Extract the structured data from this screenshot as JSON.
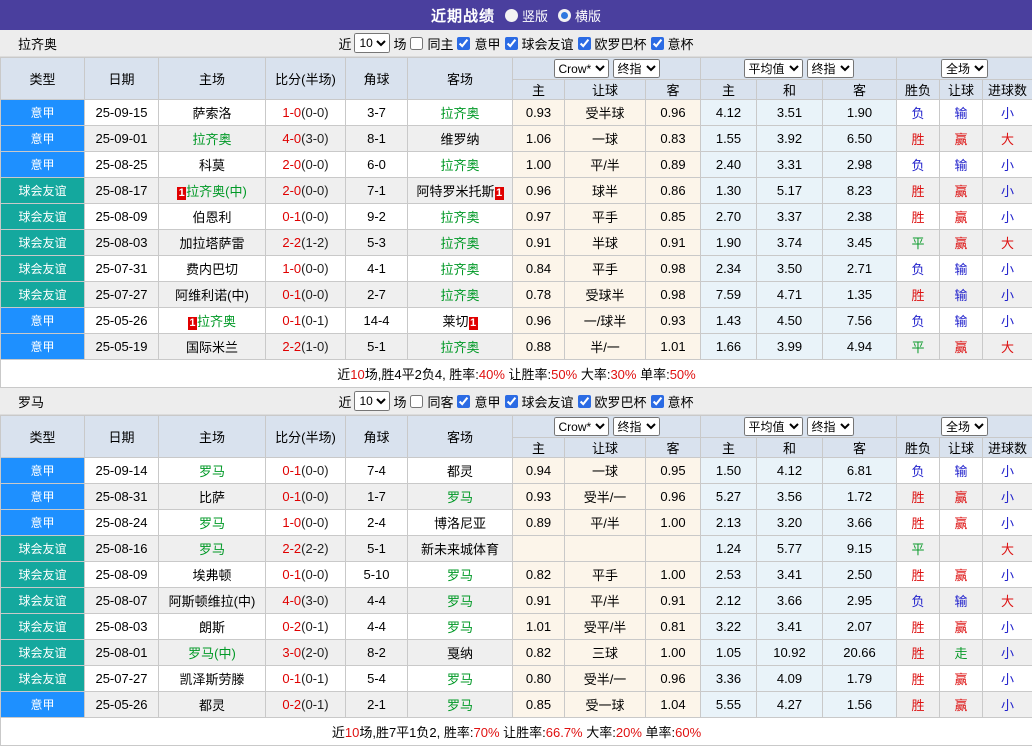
{
  "title_bar": {
    "title": "近期战绩",
    "vertical_label": "竖版",
    "horizontal_label": "横版",
    "selected": "横版"
  },
  "colors": {
    "topbar_purple": "#4a3f9e",
    "serie_a_blue": "#1e90ff",
    "friendly_teal": "#14a89e",
    "header_bg": "#d9e2ee",
    "band_bg": "#ededed",
    "alt_row_bg": "#efefef",
    "crow_col_bg": "#fcf5ea",
    "avg_col_bg": "#e9f3f9",
    "win_red": "#dd1111",
    "lose_blue": "#2222cc",
    "draw_green": "#0a9a2a",
    "team_green": "#009926",
    "score_red": "#e00000",
    "badge_red": "#e00000"
  },
  "header_columns": {
    "main": [
      "类型",
      "日期",
      "主场",
      "比分(半场)",
      "角球",
      "客场"
    ],
    "sub": [
      "主",
      "让球",
      "客",
      "主",
      "和",
      "客",
      "胜负",
      "让球",
      "进球数"
    ]
  },
  "selects": {
    "odds_provider": "Crow*",
    "final_1": "终指",
    "average": "平均值",
    "final_2": "终指",
    "scope": "全场"
  },
  "sections": [
    {
      "team": "拉齐奥",
      "filter": {
        "near_label": "近",
        "count": "10",
        "games_label": "场",
        "same_label": "同主",
        "same_checked": false,
        "leagues": [
          {
            "label": "意甲",
            "checked": true
          },
          {
            "label": "球会友谊",
            "checked": true
          },
          {
            "label": "欧罗巴杯",
            "checked": true
          },
          {
            "label": "意杯",
            "checked": true
          }
        ]
      },
      "rows": [
        {
          "type": "意甲",
          "type_style": "blue",
          "date": "25-09-15",
          "home": {
            "text": "萨索洛",
            "green": false
          },
          "score_main": "1-0",
          "score_half": "(0-0)",
          "corner": "3-7",
          "away": {
            "text": "拉齐奥",
            "green": true
          },
          "odds": [
            "0.93",
            "受半球",
            "0.96",
            "4.12",
            "3.51",
            "1.90"
          ],
          "results": [
            [
              "负",
              "b"
            ],
            [
              "输",
              "b"
            ],
            [
              "小",
              "b"
            ]
          ]
        },
        {
          "type": "意甲",
          "type_style": "blue",
          "date": "25-09-01",
          "home": {
            "text": "拉齐奥",
            "green": true
          },
          "score_main": "4-0",
          "score_half": "(3-0)",
          "corner": "8-1",
          "away": {
            "text": "维罗纳",
            "green": false
          },
          "odds": [
            "1.06",
            "一球",
            "0.83",
            "1.55",
            "3.92",
            "6.50"
          ],
          "results": [
            [
              "胜",
              "r"
            ],
            [
              "赢",
              "r"
            ],
            [
              "大",
              "r"
            ]
          ]
        },
        {
          "type": "意甲",
          "type_style": "blue",
          "date": "25-08-25",
          "home": {
            "text": "科莫",
            "green": false
          },
          "score_main": "2-0",
          "score_half": "(0-0)",
          "corner": "6-0",
          "away": {
            "text": "拉齐奥",
            "green": true
          },
          "odds": [
            "1.00",
            "平/半",
            "0.89",
            "2.40",
            "3.31",
            "2.98"
          ],
          "results": [
            [
              "负",
              "b"
            ],
            [
              "输",
              "b"
            ],
            [
              "小",
              "b"
            ]
          ]
        },
        {
          "type": "球会友谊",
          "type_style": "teal",
          "date": "25-08-17",
          "home": {
            "text": "拉齐奥(中)",
            "green": true,
            "badge_pre": "1"
          },
          "score_main": "2-0",
          "score_half": "(0-0)",
          "corner": "7-1",
          "away": {
            "text": "阿特罗米托斯",
            "green": false,
            "badge_post": "1"
          },
          "odds": [
            "0.96",
            "球半",
            "0.86",
            "1.30",
            "5.17",
            "8.23"
          ],
          "results": [
            [
              "胜",
              "r"
            ],
            [
              "赢",
              "r"
            ],
            [
              "小",
              "b"
            ]
          ]
        },
        {
          "type": "球会友谊",
          "type_style": "teal",
          "date": "25-08-09",
          "home": {
            "text": "伯恩利",
            "green": false
          },
          "score_main": "0-1",
          "score_half": "(0-0)",
          "corner": "9-2",
          "away": {
            "text": "拉齐奥",
            "green": true
          },
          "odds": [
            "0.97",
            "平手",
            "0.85",
            "2.70",
            "3.37",
            "2.38"
          ],
          "results": [
            [
              "胜",
              "r"
            ],
            [
              "赢",
              "r"
            ],
            [
              "小",
              "b"
            ]
          ]
        },
        {
          "type": "球会友谊",
          "type_style": "teal",
          "date": "25-08-03",
          "home": {
            "text": "加拉塔萨雷",
            "green": false
          },
          "score_main": "2-2",
          "score_half": "(1-2)",
          "corner": "5-3",
          "away": {
            "text": "拉齐奥",
            "green": true
          },
          "odds": [
            "0.91",
            "半球",
            "0.91",
            "1.90",
            "3.74",
            "3.45"
          ],
          "results": [
            [
              "平",
              "g"
            ],
            [
              "赢",
              "r"
            ],
            [
              "大",
              "r"
            ]
          ]
        },
        {
          "type": "球会友谊",
          "type_style": "teal",
          "date": "25-07-31",
          "home": {
            "text": "费内巴切",
            "green": false
          },
          "score_main": "1-0",
          "score_half": "(0-0)",
          "corner": "4-1",
          "away": {
            "text": "拉齐奥",
            "green": true
          },
          "odds": [
            "0.84",
            "平手",
            "0.98",
            "2.34",
            "3.50",
            "2.71"
          ],
          "results": [
            [
              "负",
              "b"
            ],
            [
              "输",
              "b"
            ],
            [
              "小",
              "b"
            ]
          ]
        },
        {
          "type": "球会友谊",
          "type_style": "teal",
          "date": "25-07-27",
          "home": {
            "text": "阿维利诺(中)",
            "green": false
          },
          "score_main": "0-1",
          "score_half": "(0-0)",
          "corner": "2-7",
          "away": {
            "text": "拉齐奥",
            "green": true
          },
          "odds": [
            "0.78",
            "受球半",
            "0.98",
            "7.59",
            "4.71",
            "1.35"
          ],
          "results": [
            [
              "胜",
              "r"
            ],
            [
              "输",
              "b"
            ],
            [
              "小",
              "b"
            ]
          ]
        },
        {
          "type": "意甲",
          "type_style": "blue",
          "date": "25-05-26",
          "home": {
            "text": "拉齐奥",
            "green": true,
            "badge_pre": "1"
          },
          "score_main": "0-1",
          "score_half": "(0-1)",
          "corner": "14-4",
          "away": {
            "text": "莱切",
            "green": false,
            "badge_post": "1"
          },
          "odds": [
            "0.96",
            "一/球半",
            "0.93",
            "1.43",
            "4.50",
            "7.56"
          ],
          "results": [
            [
              "负",
              "b"
            ],
            [
              "输",
              "b"
            ],
            [
              "小",
              "b"
            ]
          ]
        },
        {
          "type": "意甲",
          "type_style": "blue",
          "date": "25-05-19",
          "home": {
            "text": "国际米兰",
            "green": false
          },
          "score_main": "2-2",
          "score_half": "(1-0)",
          "corner": "5-1",
          "away": {
            "text": "拉齐奥",
            "green": true
          },
          "odds": [
            "0.88",
            "半/一",
            "1.01",
            "1.66",
            "3.99",
            "4.94"
          ],
          "results": [
            [
              "平",
              "g"
            ],
            [
              "赢",
              "r"
            ],
            [
              "大",
              "r"
            ]
          ]
        }
      ],
      "summary": [
        [
          "近",
          "k"
        ],
        [
          "10",
          "r"
        ],
        [
          "场,胜4平2负4, 胜率:",
          "k"
        ],
        [
          "40%",
          "r"
        ],
        [
          " 让胜率:",
          "k"
        ],
        [
          "50%",
          "r"
        ],
        [
          " 大率:",
          "k"
        ],
        [
          "30%",
          "r"
        ],
        [
          " 单率:",
          "k"
        ],
        [
          "50%",
          "r"
        ]
      ]
    },
    {
      "team": "罗马",
      "filter": {
        "near_label": "近",
        "count": "10",
        "games_label": "场",
        "same_label": "同客",
        "same_checked": false,
        "leagues": [
          {
            "label": "意甲",
            "checked": true
          },
          {
            "label": "球会友谊",
            "checked": true
          },
          {
            "label": "欧罗巴杯",
            "checked": true
          },
          {
            "label": "意杯",
            "checked": true
          }
        ]
      },
      "rows": [
        {
          "type": "意甲",
          "type_style": "blue",
          "date": "25-09-14",
          "home": {
            "text": "罗马",
            "green": true
          },
          "score_main": "0-1",
          "score_half": "(0-0)",
          "corner": "7-4",
          "away": {
            "text": "都灵",
            "green": false
          },
          "odds": [
            "0.94",
            "一球",
            "0.95",
            "1.50",
            "4.12",
            "6.81"
          ],
          "results": [
            [
              "负",
              "b"
            ],
            [
              "输",
              "b"
            ],
            [
              "小",
              "b"
            ]
          ]
        },
        {
          "type": "意甲",
          "type_style": "blue",
          "date": "25-08-31",
          "home": {
            "text": "比萨",
            "green": false
          },
          "score_main": "0-1",
          "score_half": "(0-0)",
          "corner": "1-7",
          "away": {
            "text": "罗马",
            "green": true
          },
          "odds": [
            "0.93",
            "受半/一",
            "0.96",
            "5.27",
            "3.56",
            "1.72"
          ],
          "results": [
            [
              "胜",
              "r"
            ],
            [
              "赢",
              "r"
            ],
            [
              "小",
              "b"
            ]
          ]
        },
        {
          "type": "意甲",
          "type_style": "blue",
          "date": "25-08-24",
          "home": {
            "text": "罗马",
            "green": true
          },
          "score_main": "1-0",
          "score_half": "(0-0)",
          "corner": "2-4",
          "away": {
            "text": "博洛尼亚",
            "green": false
          },
          "odds": [
            "0.89",
            "平/半",
            "1.00",
            "2.13",
            "3.20",
            "3.66"
          ],
          "results": [
            [
              "胜",
              "r"
            ],
            [
              "赢",
              "r"
            ],
            [
              "小",
              "b"
            ]
          ]
        },
        {
          "type": "球会友谊",
          "type_style": "teal",
          "date": "25-08-16",
          "home": {
            "text": "罗马",
            "green": true
          },
          "score_main": "2-2",
          "score_half": "(2-2)",
          "corner": "5-1",
          "away": {
            "text": "新未来城体育",
            "green": false
          },
          "odds": [
            "",
            "",
            "",
            "1.24",
            "5.77",
            "9.15"
          ],
          "results": [
            [
              "平",
              "g"
            ],
            [
              "",
              ""
            ],
            [
              "大",
              "r"
            ]
          ]
        },
        {
          "type": "球会友谊",
          "type_style": "teal",
          "date": "25-08-09",
          "home": {
            "text": "埃弗顿",
            "green": false
          },
          "score_main": "0-1",
          "score_half": "(0-0)",
          "corner": "5-10",
          "away": {
            "text": "罗马",
            "green": true
          },
          "odds": [
            "0.82",
            "平手",
            "1.00",
            "2.53",
            "3.41",
            "2.50"
          ],
          "results": [
            [
              "胜",
              "r"
            ],
            [
              "赢",
              "r"
            ],
            [
              "小",
              "b"
            ]
          ]
        },
        {
          "type": "球会友谊",
          "type_style": "teal",
          "date": "25-08-07",
          "home": {
            "text": "阿斯顿维拉(中)",
            "green": false
          },
          "score_main": "4-0",
          "score_half": "(3-0)",
          "corner": "4-4",
          "away": {
            "text": "罗马",
            "green": true
          },
          "odds": [
            "0.91",
            "平/半",
            "0.91",
            "2.12",
            "3.66",
            "2.95"
          ],
          "results": [
            [
              "负",
              "b"
            ],
            [
              "输",
              "b"
            ],
            [
              "大",
              "r"
            ]
          ]
        },
        {
          "type": "球会友谊",
          "type_style": "teal",
          "date": "25-08-03",
          "home": {
            "text": "朗斯",
            "green": false
          },
          "score_main": "0-2",
          "score_half": "(0-1)",
          "corner": "4-4",
          "away": {
            "text": "罗马",
            "green": true
          },
          "odds": [
            "1.01",
            "受平/半",
            "0.81",
            "3.22",
            "3.41",
            "2.07"
          ],
          "results": [
            [
              "胜",
              "r"
            ],
            [
              "赢",
              "r"
            ],
            [
              "小",
              "b"
            ]
          ]
        },
        {
          "type": "球会友谊",
          "type_style": "teal",
          "date": "25-08-01",
          "home": {
            "text": "罗马(中)",
            "green": true
          },
          "score_main": "3-0",
          "score_half": "(2-0)",
          "corner": "8-2",
          "away": {
            "text": "戛纳",
            "green": false
          },
          "odds": [
            "0.82",
            "三球",
            "1.00",
            "1.05",
            "10.92",
            "20.66"
          ],
          "results": [
            [
              "胜",
              "r"
            ],
            [
              "走",
              "g"
            ],
            [
              "小",
              "b"
            ]
          ]
        },
        {
          "type": "球会友谊",
          "type_style": "teal",
          "date": "25-07-27",
          "home": {
            "text": "凯泽斯劳滕",
            "green": false
          },
          "score_main": "0-1",
          "score_half": "(0-1)",
          "corner": "5-4",
          "away": {
            "text": "罗马",
            "green": true
          },
          "odds": [
            "0.80",
            "受半/一",
            "0.96",
            "3.36",
            "4.09",
            "1.79"
          ],
          "results": [
            [
              "胜",
              "r"
            ],
            [
              "赢",
              "r"
            ],
            [
              "小",
              "b"
            ]
          ]
        },
        {
          "type": "意甲",
          "type_style": "blue",
          "date": "25-05-26",
          "home": {
            "text": "都灵",
            "green": false
          },
          "score_main": "0-2",
          "score_half": "(0-1)",
          "corner": "2-1",
          "away": {
            "text": "罗马",
            "green": true
          },
          "odds": [
            "0.85",
            "受一球",
            "1.04",
            "5.55",
            "4.27",
            "1.56"
          ],
          "results": [
            [
              "胜",
              "r"
            ],
            [
              "赢",
              "r"
            ],
            [
              "小",
              "b"
            ]
          ]
        }
      ],
      "summary": [
        [
          "近",
          "k"
        ],
        [
          "10",
          "r"
        ],
        [
          "场,胜7平1负2, 胜率:",
          "k"
        ],
        [
          "70%",
          "r"
        ],
        [
          " 让胜率:",
          "k"
        ],
        [
          "66.7%",
          "r"
        ],
        [
          " 大率:",
          "k"
        ],
        [
          "20%",
          "r"
        ],
        [
          " 单率:",
          "k"
        ],
        [
          "60%",
          "r"
        ]
      ]
    }
  ]
}
